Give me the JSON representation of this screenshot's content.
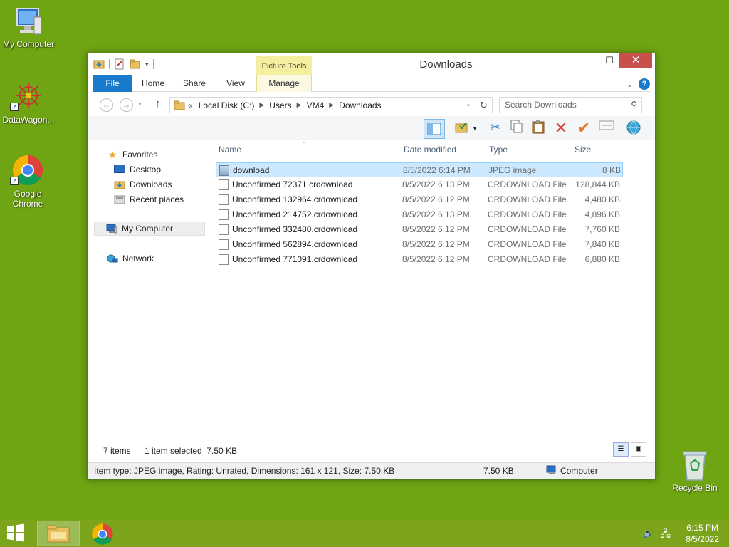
{
  "desktop": {
    "icons": [
      {
        "label": "My Computer"
      },
      {
        "label": "DataWagon..."
      },
      {
        "label": "Google Chrome"
      }
    ],
    "recycle_bin": "Recycle Bin"
  },
  "window": {
    "title": "Downloads",
    "context_tab_group": "Picture Tools",
    "ribbon_tabs": [
      "File",
      "Home",
      "Share",
      "View",
      "Manage"
    ],
    "close_glyph": "✕",
    "minimize_glyph": "—",
    "maximize_glyph": "☐"
  },
  "address": {
    "prefix": "«",
    "crumbs": [
      "Local Disk (C:)",
      "Users",
      "VM4",
      "Downloads"
    ],
    "search_placeholder": "Search Downloads"
  },
  "nav": {
    "favorites": "Favorites",
    "desktop": "Desktop",
    "downloads": "Downloads",
    "recent_places": "Recent places",
    "my_computer": "My Computer",
    "network": "Network"
  },
  "columns": {
    "name": "Name",
    "date_modified": "Date modified",
    "type": "Type",
    "size": "Size"
  },
  "files": [
    {
      "name": "download",
      "date": "8/5/2022 6:14 PM",
      "type": "JPEG image",
      "size": "8 KB"
    },
    {
      "name": "Unconfirmed 72371.crdownload",
      "date": "8/5/2022 6:13 PM",
      "type": "CRDOWNLOAD File",
      "size": "128,844 KB"
    },
    {
      "name": "Unconfirmed 132964.crdownload",
      "date": "8/5/2022 6:12 PM",
      "type": "CRDOWNLOAD File",
      "size": "4,480 KB"
    },
    {
      "name": "Unconfirmed 214752.crdownload",
      "date": "8/5/2022 6:13 PM",
      "type": "CRDOWNLOAD File",
      "size": "4,896 KB"
    },
    {
      "name": "Unconfirmed 332480.crdownload",
      "date": "8/5/2022 6:12 PM",
      "type": "CRDOWNLOAD File",
      "size": "7,760 KB"
    },
    {
      "name": "Unconfirmed 562894.crdownload",
      "date": "8/5/2022 6:12 PM",
      "type": "CRDOWNLOAD File",
      "size": "7,840 KB"
    },
    {
      "name": "Unconfirmed 771091.crdownload",
      "date": "8/5/2022 6:12 PM",
      "type": "CRDOWNLOAD File",
      "size": "6,880 KB"
    }
  ],
  "status": {
    "item_count": "7 items",
    "selection": "1 item selected  7.50 KB"
  },
  "details": {
    "info": "Item type: JPEG image, Rating: Unrated, Dimensions: 161 x 121, Size: 7.50 KB",
    "size": "7.50 KB",
    "location": "Computer"
  },
  "taskbar": {
    "time": "6:15 PM",
    "date": "8/5/2022"
  },
  "colors": {
    "desktop_bg": "#6fa512",
    "accent": "#1979ca",
    "close": "#c7504b",
    "selection": "#cce8ff"
  }
}
